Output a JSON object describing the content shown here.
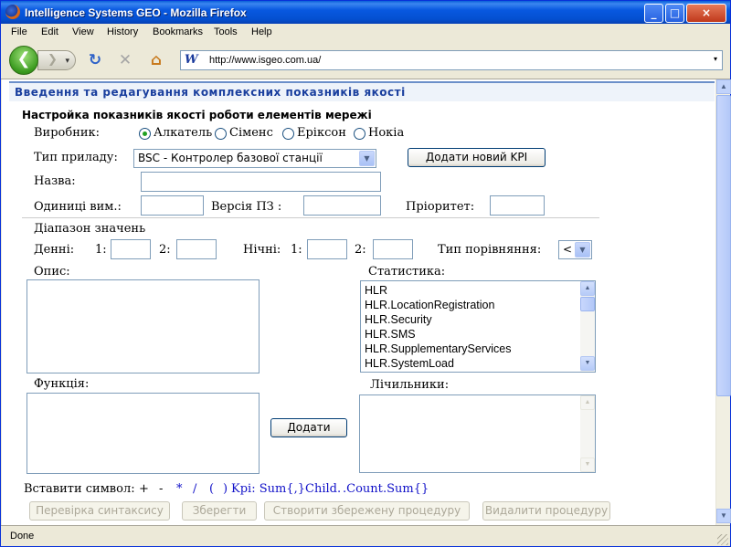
{
  "window": {
    "title": "Intelligence Systems GEO - Mozilla Firefox",
    "minimize": "_",
    "maximize": "□",
    "close": "×"
  },
  "menu": [
    "File",
    "Edit",
    "View",
    "History",
    "Bookmarks",
    "Tools",
    "Help"
  ],
  "nav": {
    "back": "❮",
    "forward": "❯",
    "forward_dropdown": "▾",
    "reload": "↻",
    "stop": "✕",
    "home": "⌂",
    "url": "http://www.isgeo.com.ua/",
    "url_dropdown": "▾",
    "site_icon": "W"
  },
  "status": {
    "text": "Done"
  },
  "page": {
    "header": "Введення та редагування комплексних показників якості",
    "section_title": "Настройка показників якості роботи елементів мережі",
    "vendor_label": "Виробник:",
    "vendors": [
      {
        "label": "Алкатель",
        "checked": true
      },
      {
        "label": "Сіменс",
        "checked": false
      },
      {
        "label": "Еріксон",
        "checked": false
      },
      {
        "label": "Нокіа",
        "checked": false
      }
    ],
    "device_type_label": "Тип приладу:",
    "device_type_value": "BSC - Контролер базової станції",
    "add_kpi_button": "Додати новий KPI",
    "name_label": "Назва:",
    "units_label": "Одиниці вим.:",
    "sw_version_label": "Версія ПЗ :",
    "priority_label": "Пріоритет:",
    "range_label": "Діапазон значень",
    "day_label": "Денні:",
    "night_label": "Нічні:",
    "one_label": "1:",
    "two_label": "2:",
    "compare_type_label": "Тип порівняння:",
    "compare_type_value": "<",
    "description_label": "Опис:",
    "statistics_label": "Статистика:",
    "statistics_items": [
      "HLR",
      "HLR.LocationRegistration",
      "HLR.Security",
      "HLR.SMS",
      "HLR.SupplementaryServices",
      "HLR.SystemLoad"
    ],
    "function_label": "Функція:",
    "counters_label": "Лічильники:",
    "add_button": "Додати",
    "insert_symbol_label": "Вставити символ:",
    "symbols": [
      "+",
      "-",
      "*",
      "/",
      "(",
      ")",
      "Kpi: Sum{,}",
      "Child.",
      ".Count",
      ".Sum{}"
    ],
    "buttons": {
      "check_syntax": "Перевірка синтаксису",
      "save": "Зберегти",
      "create_procedure": "Створити збережену процедуру",
      "delete_procedure": "Видалити процедуру"
    }
  }
}
